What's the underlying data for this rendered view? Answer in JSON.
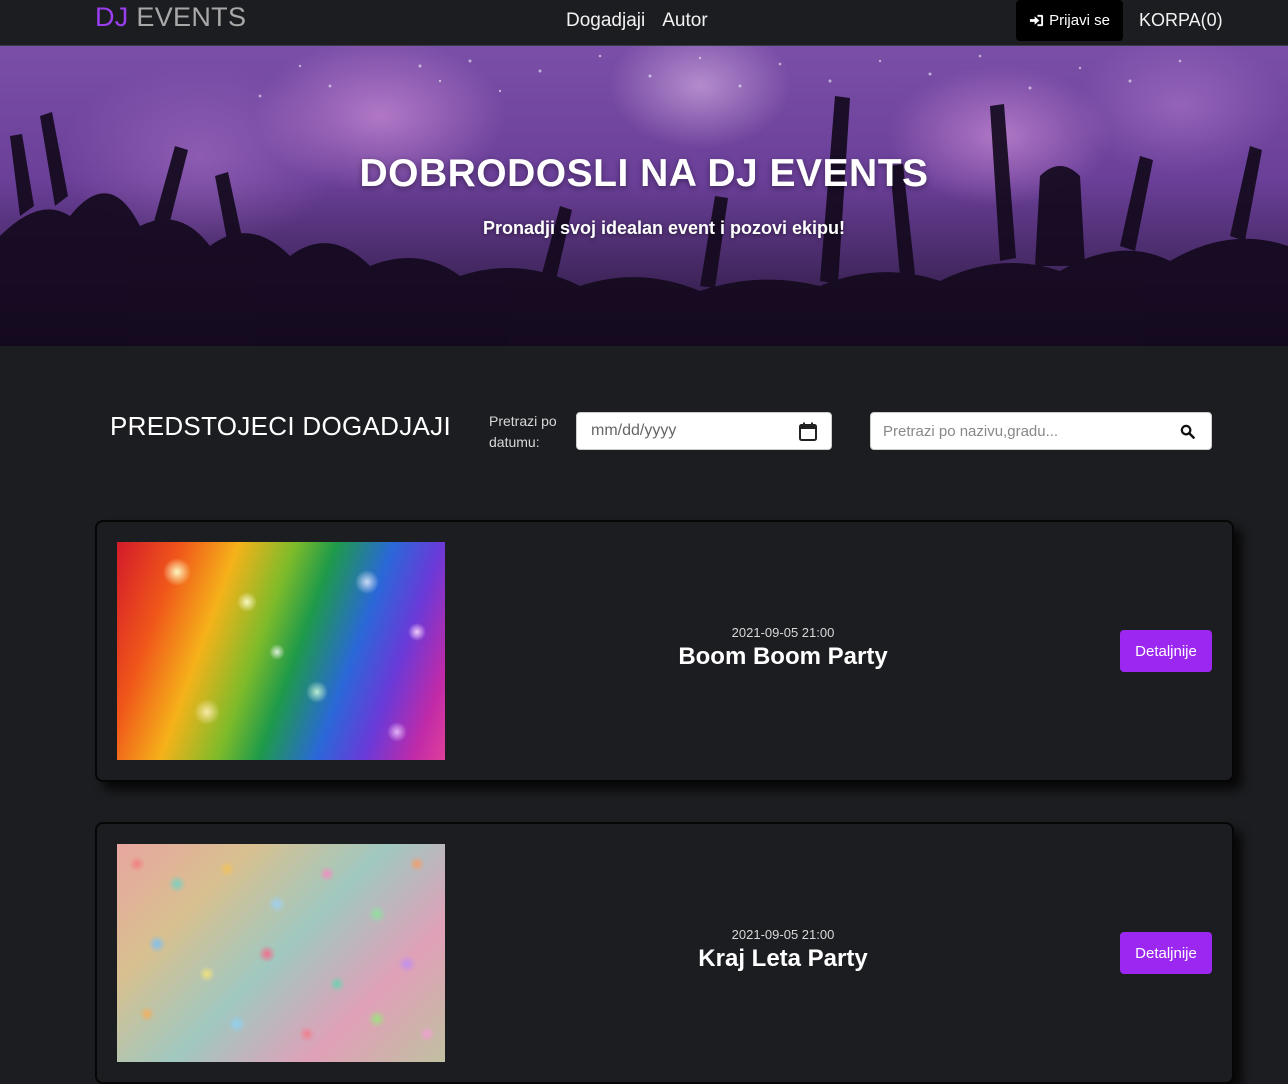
{
  "navbar": {
    "brand_dj": "DJ",
    "brand_events": "EVENTS",
    "links": [
      "Dogadjaji",
      "Autor"
    ],
    "login_label": "Prijavi se",
    "cart_label": "KORPA(0)"
  },
  "hero": {
    "title": "DOBRODOSLI NA DJ EVENTS",
    "subtitle": "Pronadji svoj idealan event i pozovi ekipu!"
  },
  "filters": {
    "section_title": "PREDSTOJECI DOGADJAJI",
    "date_label": "Pretrazi po datumu:",
    "date_placeholder": "mm/dd/yyyy",
    "search_placeholder": "Pretrazi po nazivu,gradu..."
  },
  "events": [
    {
      "datetime": "2021-09-05 21:00",
      "name": "Boom Boom Party",
      "button": "Detaljnije"
    },
    {
      "datetime": "2021-09-05 21:00",
      "name": "Kraj Leta Party",
      "button": "Detaljnije"
    }
  ],
  "colors": {
    "accent": "#9b27f0",
    "brand_purple": "#9b3df0",
    "background": "#1c1d20"
  }
}
